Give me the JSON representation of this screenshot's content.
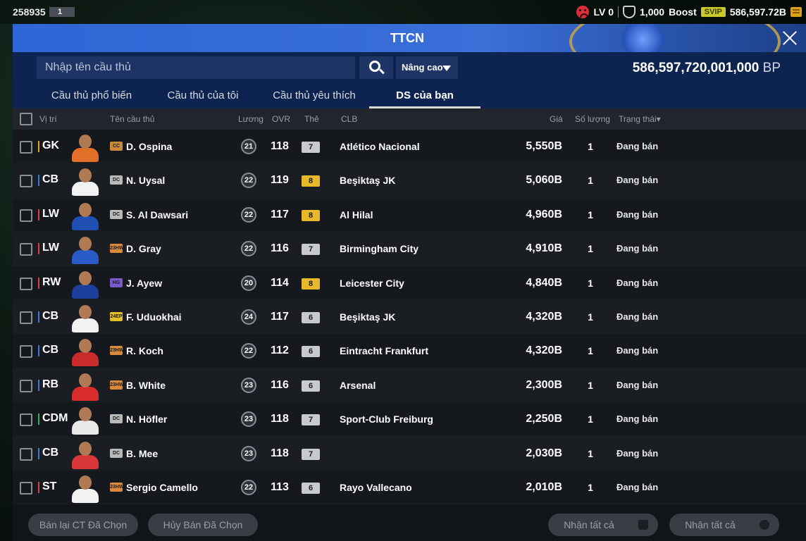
{
  "topbar": {
    "uid": "258935",
    "badge": "1",
    "level": "LV 0",
    "shield_value": "1,000",
    "boost_label": "Boost",
    "svip_label": "SVIP",
    "currency_value": "586,597.72B"
  },
  "window": {
    "title": "TTCN"
  },
  "search": {
    "placeholder": "Nhập tên cầu thủ",
    "advanced_label": "Nâng cao",
    "bp_value": "586,597,720,001,000",
    "bp_unit": "BP"
  },
  "tabs": [
    {
      "label": "Cầu thủ phổ biến"
    },
    {
      "label": "Cầu thủ của tôi"
    },
    {
      "label": "Cầu thủ yêu thích"
    },
    {
      "label": "DS của bạn",
      "active": true
    }
  ],
  "columns": {
    "position": "Vị trí",
    "name": "Tên cầu thủ",
    "salary": "Lương",
    "ovr": "OVR",
    "card": "Thẻ",
    "club": "CLB",
    "price": "Giá",
    "quantity": "Số lượng",
    "status": "Trạng thái▾"
  },
  "players": [
    {
      "pos": "GK",
      "pos_color": "#e8a21c",
      "season": "CC",
      "season_color": "#c98a3a",
      "name": "D. Ospina",
      "salary": "21",
      "ovr": "118",
      "card": "7",
      "card_color": "grey",
      "club": "Atlético Nacional",
      "price": "5,550B",
      "qty": "1",
      "status": "Đang bán",
      "kit": "#e2702a"
    },
    {
      "pos": "CB",
      "pos_color": "#3a7bd5",
      "season": "DC",
      "season_color": "#b9b9b9",
      "name": "N. Uysal",
      "salary": "22",
      "ovr": "119",
      "card": "8",
      "card_color": "gold",
      "club": "Beşiktaş JK",
      "price": "5,060B",
      "qty": "1",
      "status": "Đang bán",
      "kit": "#f2f2f2"
    },
    {
      "pos": "LW",
      "pos_color": "#d94040",
      "season": "DC",
      "season_color": "#b9b9b9",
      "name": "S. Al Dawsari",
      "salary": "22",
      "ovr": "117",
      "card": "8",
      "card_color": "gold",
      "club": "Al Hilal",
      "price": "4,960B",
      "qty": "1",
      "status": "Đang bán",
      "kit": "#1f4fb0"
    },
    {
      "pos": "LW",
      "pos_color": "#d94040",
      "season": "23HW",
      "season_color": "#d98a3a",
      "name": "D. Gray",
      "salary": "22",
      "ovr": "116",
      "card": "7",
      "card_color": "grey",
      "club": "Birmingham City",
      "price": "4,910B",
      "qty": "1",
      "status": "Đang bán",
      "kit": "#2a5bc6"
    },
    {
      "pos": "RW",
      "pos_color": "#d94040",
      "season": "HG",
      "season_color": "#7a5ac9",
      "name": "J. Ayew",
      "salary": "20",
      "ovr": "114",
      "card": "8",
      "card_color": "gold",
      "club": "Leicester City",
      "price": "4,840B",
      "qty": "1",
      "status": "Đang bán",
      "kit": "#1c3f9c"
    },
    {
      "pos": "CB",
      "pos_color": "#3a7bd5",
      "season": "24EP",
      "season_color": "#e0c02a",
      "name": "F. Uduokhai",
      "salary": "24",
      "ovr": "117",
      "card": "6",
      "card_color": "grey",
      "club": "Beşiktaş JK",
      "price": "4,320B",
      "qty": "1",
      "status": "Đang bán",
      "kit": "#f2f2f2"
    },
    {
      "pos": "CB",
      "pos_color": "#3a7bd5",
      "season": "23HW",
      "season_color": "#d98a3a",
      "name": "R. Koch",
      "salary": "22",
      "ovr": "112",
      "card": "6",
      "card_color": "grey",
      "club": "Eintracht Frankfurt",
      "price": "4,320B",
      "qty": "1",
      "status": "Đang bán",
      "kit": "#c92a2a"
    },
    {
      "pos": "RB",
      "pos_color": "#3a7bd5",
      "season": "23HW",
      "season_color": "#d98a3a",
      "name": "B. White",
      "salary": "23",
      "ovr": "116",
      "card": "6",
      "card_color": "grey",
      "club": "Arsenal",
      "price": "2,300B",
      "qty": "1",
      "status": "Đang bán",
      "kit": "#d92d2d"
    },
    {
      "pos": "CDM",
      "pos_color": "#2fb05a",
      "season": "DC",
      "season_color": "#b9b9b9",
      "name": "N. Höfler",
      "salary": "23",
      "ovr": "118",
      "card": "7",
      "card_color": "grey",
      "club": "Sport-Club Freiburg",
      "price": "2,250B",
      "qty": "1",
      "status": "Đang bán",
      "kit": "#e8e8e8"
    },
    {
      "pos": "CB",
      "pos_color": "#3a7bd5",
      "season": "DC",
      "season_color": "#b9b9b9",
      "name": "B. Mee",
      "salary": "23",
      "ovr": "118",
      "card": "7",
      "card_color": "grey",
      "club": "",
      "price": "2,030B",
      "qty": "1",
      "status": "Đang bán",
      "kit": "#d93838"
    },
    {
      "pos": "ST",
      "pos_color": "#d94040",
      "season": "23HW",
      "season_color": "#d98a3a",
      "name": "Sergio Camello",
      "salary": "22",
      "ovr": "113",
      "card": "6",
      "card_color": "grey",
      "club": "Rayo Vallecano",
      "price": "2,010B",
      "qty": "1",
      "status": "Đang bán",
      "kit": "#f2f2f2"
    }
  ],
  "bottom": {
    "resell_label": "Bán lại CT Đã Chọn",
    "cancel_label": "Hủy Bán Đã Chọn",
    "claim_all_items_label": "Nhận tất cả",
    "claim_all_coins_label": "Nhận tất cả"
  }
}
